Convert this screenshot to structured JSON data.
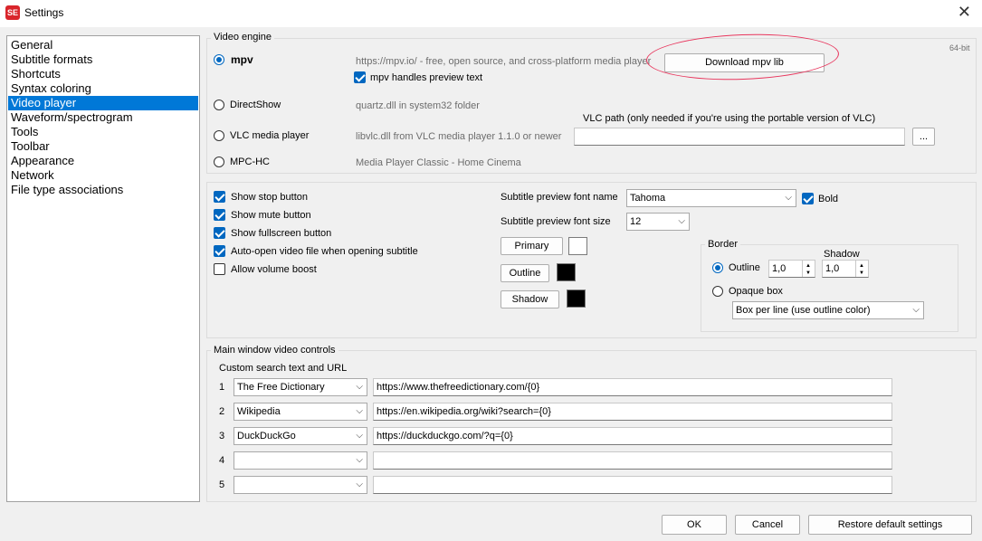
{
  "window": {
    "title": "Settings",
    "app_icon_text": "SE"
  },
  "nav": {
    "items": [
      {
        "label": "General"
      },
      {
        "label": "Subtitle formats"
      },
      {
        "label": "Shortcuts"
      },
      {
        "label": "Syntax coloring"
      },
      {
        "label": "Video player",
        "selected": true
      },
      {
        "label": "Waveform/spectrogram"
      },
      {
        "label": "Tools"
      },
      {
        "label": "Toolbar"
      },
      {
        "label": "Appearance"
      },
      {
        "label": "Network"
      },
      {
        "label": "File type associations"
      }
    ]
  },
  "video_engine": {
    "title": "Video engine",
    "bitness": "64-bit",
    "mpv": {
      "label": "mpv",
      "desc": "https://mpv.io/ - free, open source, and cross-platform media player",
      "selected": true
    },
    "mpv_download_button": "Download mpv lib",
    "mpv_preview_text": {
      "label": "mpv handles preview text",
      "checked": true
    },
    "directshow": {
      "label": "DirectShow",
      "desc": "quartz.dll in system32 folder"
    },
    "vlc": {
      "label": "VLC media player",
      "desc": "libvlc.dll from VLC media player 1.1.0 or newer"
    },
    "vlc_path_label": "VLC path (only needed if you're using the portable version of VLC)",
    "vlc_path_value": "",
    "browse_button": "...",
    "mpchc": {
      "label": "MPC-HC",
      "desc": "Media Player Classic - Home Cinema"
    }
  },
  "options": {
    "show_stop": {
      "label": "Show stop button",
      "checked": true
    },
    "show_mute": {
      "label": "Show mute button",
      "checked": true
    },
    "show_fullscreen": {
      "label": "Show fullscreen button",
      "checked": true
    },
    "auto_open": {
      "label": "Auto-open video file when opening subtitle",
      "checked": true
    },
    "volume_boost": {
      "label": "Allow volume boost",
      "checked": false
    },
    "font_name_label": "Subtitle preview font name",
    "font_name": "Tahoma",
    "bold": {
      "label": "Bold",
      "checked": true
    },
    "font_size_label": "Subtitle preview font size",
    "font_size": "12",
    "primary_button": "Primary",
    "outline_button": "Outline",
    "shadow_button": "Shadow",
    "colors": {
      "primary": "#ffffff",
      "outline": "#000000",
      "shadow": "#000000"
    },
    "border": {
      "title": "Border",
      "shadow_label": "Shadow",
      "outline_label": "Outline",
      "outline_value": "1,0",
      "shadow_value": "1,0",
      "opaque_label": "Opaque box",
      "box_mode": "Box per line (use outline color)"
    }
  },
  "main_controls": {
    "title": "Main window video controls",
    "search_label": "Custom search text and URL",
    "rows": [
      {
        "num": "1",
        "name": "The Free Dictionary",
        "url": "https://www.thefreedictionary.com/{0}"
      },
      {
        "num": "2",
        "name": "Wikipedia",
        "url": "https://en.wikipedia.org/wiki?search={0}"
      },
      {
        "num": "3",
        "name": "DuckDuckGo",
        "url": "https://duckduckgo.com/?q={0}"
      },
      {
        "num": "4",
        "name": "",
        "url": ""
      },
      {
        "num": "5",
        "name": "",
        "url": ""
      }
    ]
  },
  "footer": {
    "ok": "OK",
    "cancel": "Cancel",
    "restore": "Restore default settings"
  },
  "accent_color": "#0067c0",
  "selection_color": "#0078d7",
  "annotation_color": "#e8365d"
}
